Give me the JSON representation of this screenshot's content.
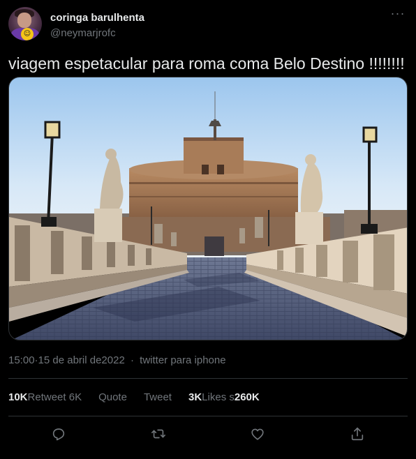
{
  "user": {
    "display_name": "coringa barulhenta",
    "handle": "@neymarjrofc",
    "avatar_icon": "profile-avatar"
  },
  "tweet": {
    "text": "viagem espetacular para roma coma Belo Destino !!!!!!!!",
    "image_description_icon": "photo-castel-sant-angelo"
  },
  "meta": {
    "time": "15:00·15 de abril de2022",
    "separator": "·",
    "source": "twitter para iphone"
  },
  "stats": {
    "retweets_count": "10K",
    "retweets_label": "Retweet 6K",
    "quotes_label": "Quote",
    "tweet_label": "Tweet",
    "likes_count": "3K",
    "likes_label": "Likes s",
    "likes_extra": "260K"
  },
  "actions": {
    "reply_icon": "reply-icon",
    "retweet_icon": "retweet-icon",
    "like_icon": "heart-icon",
    "share_icon": "share-icon"
  },
  "colors": {
    "background": "#000000",
    "text": "#e7e9ea",
    "secondary": "#71767b",
    "border": "#2f3336"
  }
}
